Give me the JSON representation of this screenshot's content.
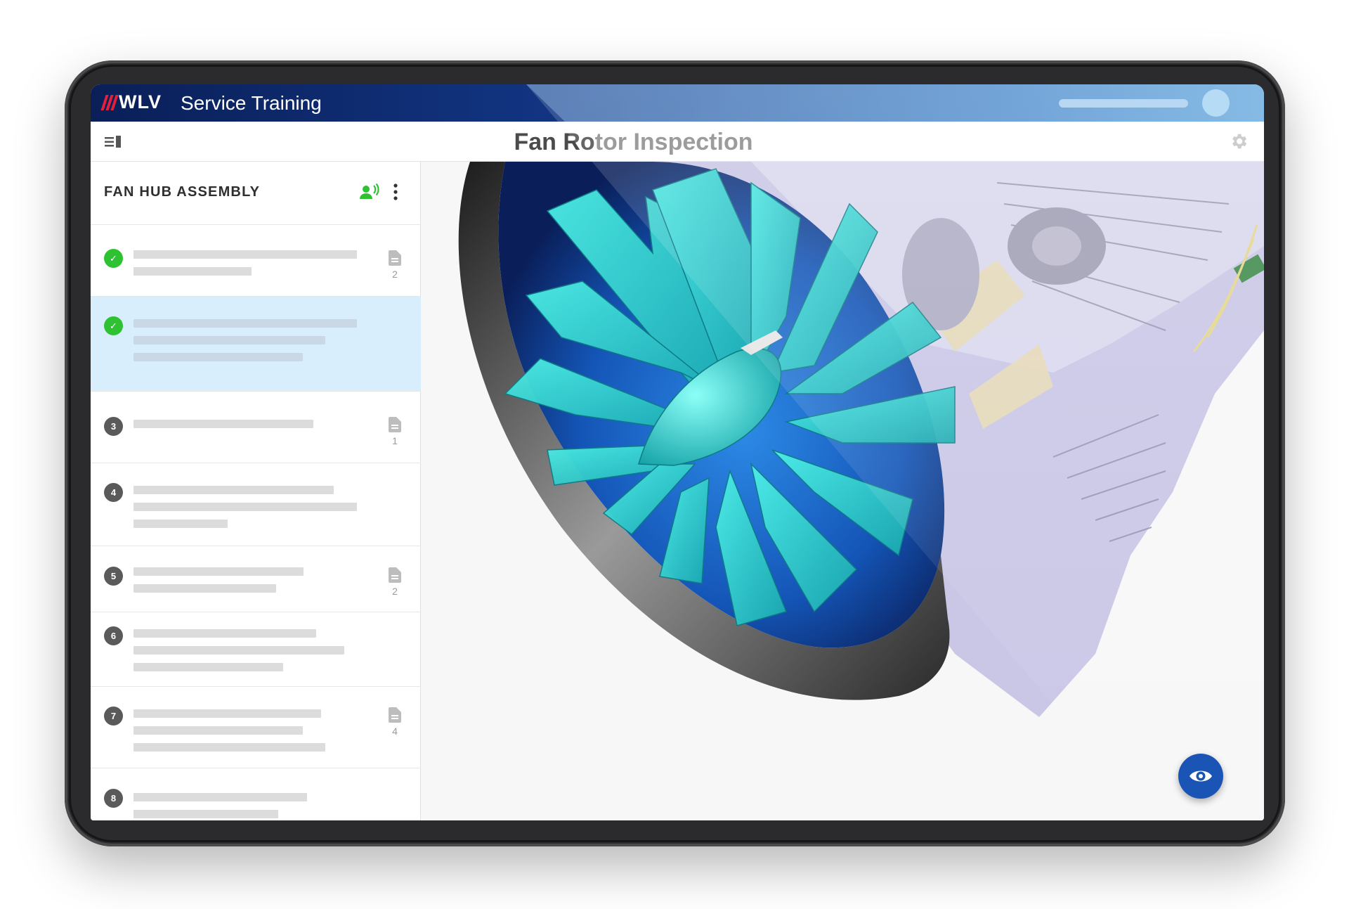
{
  "app": {
    "logo_text": "WLV",
    "name": "Service Training"
  },
  "header": {
    "title_part1": "Fan Ro",
    "title_part2": "tor Inspection"
  },
  "sidebar": {
    "title": "FAN HUB ASSEMBLY",
    "steps": [
      {
        "badge": "✓",
        "status": "done",
        "doc_count": "2"
      },
      {
        "badge": "✓",
        "status": "done",
        "doc_count": ""
      },
      {
        "badge": "3",
        "status": "pending",
        "doc_count": "1"
      },
      {
        "badge": "4",
        "status": "pending",
        "doc_count": ""
      },
      {
        "badge": "5",
        "status": "pending",
        "doc_count": "2"
      },
      {
        "badge": "6",
        "status": "pending",
        "doc_count": ""
      },
      {
        "badge": "7",
        "status": "pending",
        "doc_count": "4"
      },
      {
        "badge": "8",
        "status": "pending",
        "doc_count": ""
      }
    ]
  },
  "colors": {
    "accent": "#1a55b5",
    "done": "#2ec233",
    "active_row": "#d9eefc",
    "model_blade": "#2ad3d0"
  },
  "icons": {
    "menu": "sidebar-toggle-icon",
    "settings": "gear-icon",
    "voice": "voice-assistant-icon",
    "more": "kebab-icon",
    "document": "document-icon",
    "view": "eye-icon"
  }
}
